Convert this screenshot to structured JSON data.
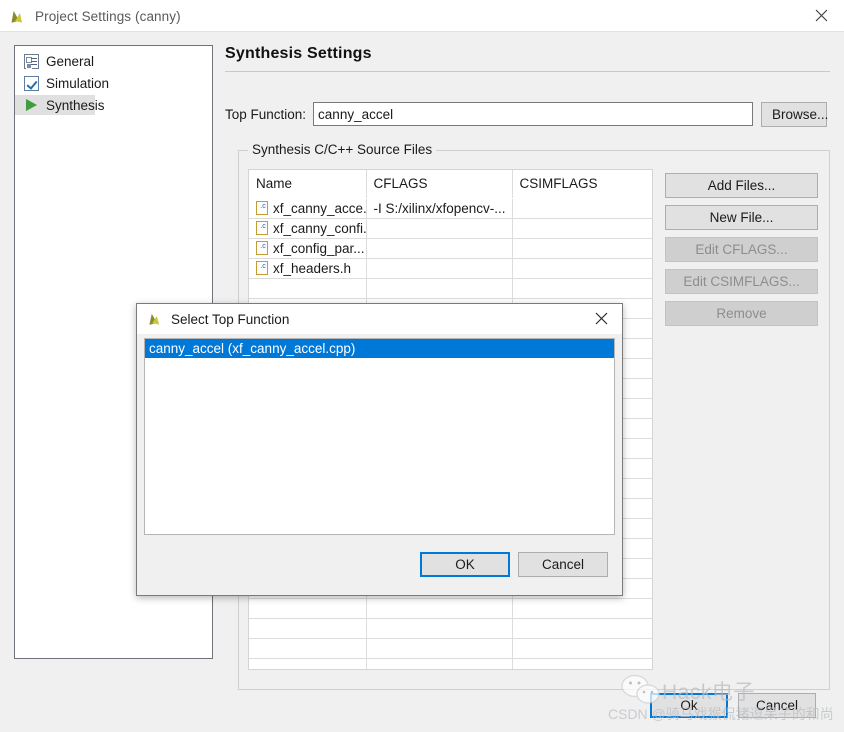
{
  "window": {
    "title": "Project Settings (canny)",
    "icon": "vivado-leaf-icon",
    "close_label": "close-icon"
  },
  "sidebar": {
    "items": [
      {
        "label": "General",
        "icon": "properties-list-icon",
        "selected": false
      },
      {
        "label": "Simulation",
        "icon": "checkbox-icon",
        "selected": false
      },
      {
        "label": "Synthesis",
        "icon": "green-play-icon",
        "selected": true
      }
    ]
  },
  "main": {
    "page_title": "Synthesis Settings",
    "top_function": {
      "label": "Top Function:",
      "value": "canny_accel",
      "placeholder": "",
      "browse_label": "Browse..."
    },
    "group": {
      "legend": "Synthesis C/C++ Source Files",
      "table": {
        "columns": [
          "Name",
          "CFLAGS",
          "CSIMFLAGS"
        ],
        "rows": [
          {
            "name": "xf_canny_acce...",
            "cflags": "-I S:/xilinx/xfopencv-...",
            "csimflags": ""
          },
          {
            "name": "xf_canny_confi...",
            "cflags": "",
            "csimflags": ""
          },
          {
            "name": "xf_config_par...",
            "cflags": "",
            "csimflags": ""
          },
          {
            "name": "xf_headers.h",
            "cflags": "",
            "csimflags": ""
          }
        ],
        "empty_row_count": 20
      },
      "buttons": [
        {
          "label": "Add Files...",
          "enabled": true
        },
        {
          "label": "New File...",
          "enabled": true
        },
        {
          "label": "Edit CFLAGS...",
          "enabled": false
        },
        {
          "label": "Edit CSIMFLAGS...",
          "enabled": false
        },
        {
          "label": "Remove",
          "enabled": false
        }
      ]
    },
    "footer": {
      "ok_label": "Ok",
      "cancel_label": "Cancel"
    }
  },
  "dialog": {
    "title": "Select Top Function",
    "icon": "vivado-leaf-icon",
    "close_label": "close-icon",
    "items": [
      {
        "label": "canny_accel (xf_canny_accel.cpp)",
        "selected": true
      }
    ],
    "ok_label": "OK",
    "cancel_label": "Cancel"
  },
  "watermark": {
    "brand": "Hack电子",
    "csdn": "CSDN @骑马戏猴侃猪逗呆子的和尚",
    "wechat_icon": "wechat-icon"
  },
  "colors": {
    "accent": "#0078d7",
    "selection": "#0078d7",
    "window_bg": "#f0f0f0",
    "panel_bg": "#ffffff",
    "disabled_text": "#8d8d8d"
  }
}
